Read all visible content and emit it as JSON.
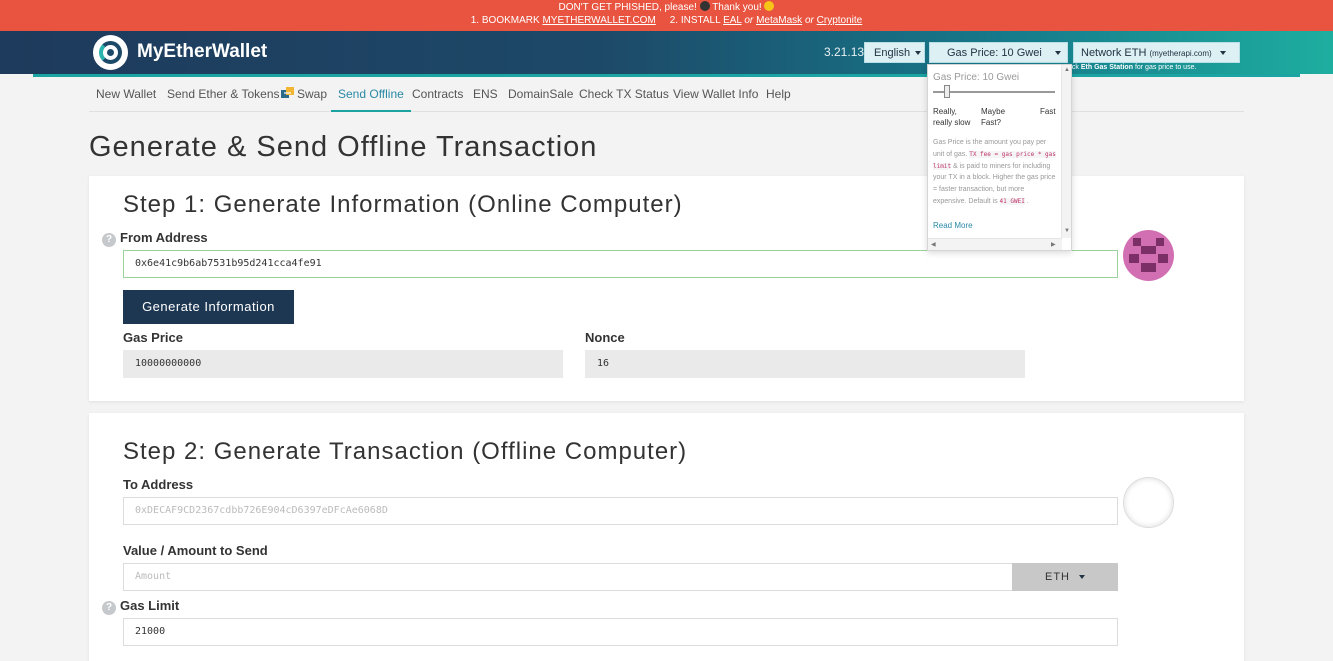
{
  "banner": {
    "line1_pre": "DON'T GET PHISHED, please!",
    "line1_post": "Thank you!",
    "line2_a": "1. BOOKMARK",
    "bookmark_link": "MYETHERWALLET.COM",
    "line2_b": "2. INSTALL",
    "eal_link": "EAL",
    "or1": "or",
    "metamask_link": "MetaMask",
    "or2": "or",
    "cryptonite_link": "Cryptonite"
  },
  "header": {
    "brand": "MyEtherWallet",
    "version": "3.21.13",
    "language": "English",
    "gas_button": "Gas Price: 10 Gwei",
    "network_label": "Network ETH",
    "network_sub": "(myetherapi.com)",
    "gas_note_pre": "eck",
    "gas_note_link": "Eth Gas Station",
    "gas_note_post": "for gas price to use."
  },
  "nav": {
    "items": [
      {
        "label": "New Wallet"
      },
      {
        "label": "Send Ether & Tokens"
      },
      {
        "label": "Swap"
      },
      {
        "label": "Send Offline"
      },
      {
        "label": "Contracts"
      },
      {
        "label": "ENS"
      },
      {
        "label": "DomainSale"
      },
      {
        "label": "Check TX Status"
      },
      {
        "label": "View Wallet Info"
      },
      {
        "label": "Help"
      }
    ],
    "active": "Send Offline"
  },
  "page_title": "Generate & Send Offline Transaction",
  "step1": {
    "title": "Step 1: Generate Information (Online Computer)",
    "from_label": "From Address",
    "from_value": "0x6e41c9b6ab7531b95d241cca4fe91",
    "generate_button": "Generate Information",
    "gas_price_label": "Gas Price",
    "gas_price_value": "10000000000",
    "nonce_label": "Nonce",
    "nonce_value": "16"
  },
  "step2": {
    "title": "Step 2: Generate Transaction (Offline Computer)",
    "to_label": "To Address",
    "to_placeholder": "0xDECAF9CD2367cdbb726E904cD6397eDFcAe6068D",
    "value_label": "Value / Amount to Send",
    "amount_placeholder": "Amount",
    "currency": "ETH",
    "gas_limit_label": "Gas Limit",
    "gas_limit_value": "21000"
  },
  "gas_dropdown": {
    "title": "Gas Price: 10 Gwei",
    "slider_level": 0.09,
    "label_slow": "Really, really slow",
    "label_maybe": "Maybe Fast?",
    "label_fast": "Fast",
    "desc_1": "Gas Price is the amount you pay per unit of gas.",
    "desc_code": "TX fee = gas price * gas limit",
    "desc_2": "& is paid to miners for including your TX in a block. Higher the gas price = faster transaction, but more expensive. Default is",
    "desc_default": "41 GWEI",
    "desc_end": ".",
    "read_more": "Read More"
  },
  "colors": {
    "banner": "#e85440",
    "header_dark": "#1e3a5c",
    "header_teal": "#1eaea0",
    "primary_button": "#1d3651",
    "accent": "#2a8aa6",
    "identicon": "#d26fb3"
  }
}
